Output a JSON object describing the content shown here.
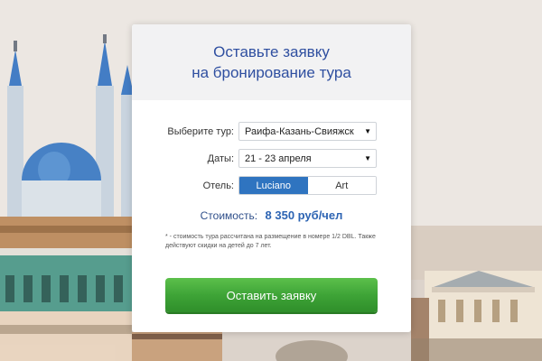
{
  "form": {
    "title_line1": "Оставьте заявку",
    "title_line2": "на бронирование тура",
    "tour_label": "Выберите тур:",
    "tour_value": "Раифа-Казань-Свияжск",
    "dates_label": "Даты:",
    "dates_value": "21 - 23 апреля",
    "hotel_label": "Отель:",
    "hotel_options": [
      "Luciano",
      "Art"
    ],
    "hotel_selected": "Luciano",
    "price_label": "Стоимость:",
    "price_value": "8 350 руб/чел",
    "note": "* - стоимость тура рассчитана на размещение в номере 1/2 DBL. Также действуют скидки на детей до 7 лет.",
    "submit_label": "Оставить заявку"
  },
  "colors": {
    "title": "#2f4fa0",
    "accent": "#2f74c0",
    "button": "#3ea437"
  }
}
